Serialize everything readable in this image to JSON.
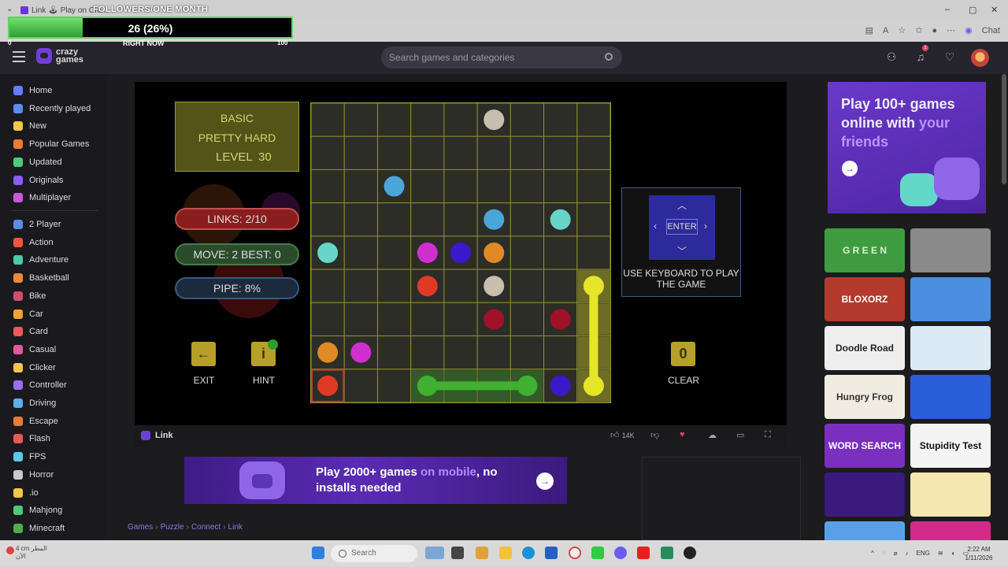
{
  "browser": {
    "tab_title": "Link 🕹 Play on Cra...",
    "chat_label": "Chat"
  },
  "overlay": {
    "title": "FOLLOWERS/ONE MONTH",
    "count": "26 (26%)",
    "progress_fraction": 0.26,
    "min_label": "0",
    "now_label": "RIGHT NOW",
    "max_label": "100"
  },
  "header": {
    "logo_line1": "crazy",
    "logo_line2": "games",
    "search_placeholder": "Search games and categories",
    "notification_count": "1"
  },
  "sidebar": {
    "items": [
      {
        "label": "Home",
        "color": "#6a7cf2"
      },
      {
        "label": "Recently played",
        "color": "#5a8de8"
      },
      {
        "label": "New",
        "color": "#f2c64a"
      },
      {
        "label": "Popular Games",
        "color": "#ef7a35"
      },
      {
        "label": "Updated",
        "color": "#4fc97a"
      },
      {
        "label": "Originals",
        "color": "#8a5cf0"
      },
      {
        "label": "Multiplayer",
        "color": "#c85ad9"
      },
      {
        "label": "2 Player",
        "color": "#5a8de8"
      },
      {
        "label": "Action",
        "color": "#e8593a"
      },
      {
        "label": "Adventure",
        "color": "#4fc9a7"
      },
      {
        "label": "Basketball",
        "color": "#ef8a35"
      },
      {
        "label": "Bike",
        "color": "#d64a6f"
      },
      {
        "label": "Car",
        "color": "#f2a23a"
      },
      {
        "label": "Card",
        "color": "#e85a5a"
      },
      {
        "label": "Casual",
        "color": "#e05aa0"
      },
      {
        "label": "Clicker",
        "color": "#f2c64a"
      },
      {
        "label": "Controller",
        "color": "#9a6ef0"
      },
      {
        "label": "Driving",
        "color": "#5ab0e8"
      },
      {
        "label": "Escape",
        "color": "#e87a3a"
      },
      {
        "label": "Flash",
        "color": "#e85a5a"
      },
      {
        "label": "FPS",
        "color": "#5ac9e8"
      },
      {
        "label": "Horror",
        "color": "#c8c8c8"
      },
      {
        "label": ".io",
        "color": "#f2c64a"
      },
      {
        "label": "Mahjong",
        "color": "#4fc97a"
      },
      {
        "label": "Minecraft",
        "color": "#4fae4a"
      }
    ]
  },
  "game": {
    "level_mode": "BASIC",
    "difficulty": "PRETTY HARD",
    "level_label": "LEVEL",
    "level_value": "30",
    "links": "LINKS:  2/10",
    "moves": "MOVE: 2    BEST: 0",
    "pipe": "PIPE:  8%",
    "exit_label": "EXIT",
    "hint_label": "HINT",
    "clear_label": "CLEAR",
    "clear_count": "0",
    "enter_label": "ENTER",
    "keyboard_text": "USE KEYBOARD TO PLAY THE GAME",
    "dots": [
      {
        "col": 5,
        "row": 0,
        "color": "#c9bfae"
      },
      {
        "col": 2,
        "row": 2,
        "color": "#4aa6d9"
      },
      {
        "col": 5,
        "row": 3,
        "color": "#4aa6d9"
      },
      {
        "col": 7,
        "row": 3,
        "color": "#67d6c8"
      },
      {
        "col": 0,
        "row": 4,
        "color": "#67d6c8"
      },
      {
        "col": 3,
        "row": 4,
        "color": "#d02fcf"
      },
      {
        "col": 4,
        "row": 4,
        "color": "#3b18c9"
      },
      {
        "col": 5,
        "row": 4,
        "color": "#e08a25"
      },
      {
        "col": 3,
        "row": 5,
        "color": "#e03a25"
      },
      {
        "col": 5,
        "row": 5,
        "color": "#c9bfae"
      },
      {
        "col": 5,
        "row": 6,
        "color": "#a0122a"
      },
      {
        "col": 7,
        "row": 6,
        "color": "#a0122a"
      },
      {
        "col": 0,
        "row": 7,
        "color": "#e08a25"
      },
      {
        "col": 1,
        "row": 7,
        "color": "#d02fcf"
      },
      {
        "col": 0,
        "row": 8,
        "color": "#e03a25"
      },
      {
        "col": 7,
        "row": 8,
        "color": "#3b18c9"
      }
    ],
    "pipes": [
      {
        "color": "#3fb02f",
        "cells": [
          [
            3,
            8
          ],
          [
            4,
            8
          ],
          [
            5,
            8
          ],
          [
            6,
            8
          ]
        ]
      },
      {
        "color": "#e5e52a",
        "cells": [
          [
            8,
            5
          ],
          [
            8,
            6
          ],
          [
            8,
            7
          ],
          [
            8,
            8
          ]
        ]
      }
    ]
  },
  "infobar": {
    "game_name": "Link",
    "likes": "14K"
  },
  "banner": {
    "text_a": "Play 2000+ games ",
    "text_highlight": "on mobile",
    "text_b": ", no installs needed"
  },
  "breadcrumb": [
    "Games",
    "Puzzle",
    "Connect",
    "Link"
  ],
  "promo": {
    "text_a": "Play 100+ games online with ",
    "text_highlight": "your friends"
  },
  "thumbnails": [
    {
      "label": "G R E E N",
      "bg": "#3f9b3f",
      "fg": "#d6f2d6"
    },
    {
      "label": "",
      "bg": "#8a8a8a",
      "fg": "#ffffff"
    },
    {
      "label": "BLOXORZ",
      "bg": "#b33a2d",
      "fg": "#ffffff"
    },
    {
      "label": "",
      "bg": "#4b8fe0",
      "fg": "#ffffff"
    },
    {
      "label": "Doodle Road",
      "bg": "#eeeeee",
      "fg": "#222222"
    },
    {
      "label": "",
      "bg": "#dceaf5",
      "fg": "#4b8fe0"
    },
    {
      "label": "Hungry Frog",
      "bg": "#f0ece2",
      "fg": "#333333"
    },
    {
      "label": "",
      "bg": "#2b5fd9",
      "fg": "#ffffff"
    },
    {
      "label": "WORD SEARCH",
      "bg": "#7a2fbf",
      "fg": "#ffffff"
    },
    {
      "label": "Stupidity Test",
      "bg": "#f4f4f4",
      "fg": "#111111"
    },
    {
      "label": "",
      "bg": "#3a1a7a",
      "fg": "#ffffff"
    },
    {
      "label": "",
      "bg": "#f4e7b0",
      "fg": "#b08a20"
    },
    {
      "label": "",
      "bg": "#5aa0e8",
      "fg": "#ffffff"
    },
    {
      "label": "",
      "bg": "#d62a8a",
      "fg": "#ffffff"
    }
  ],
  "taskbar": {
    "weather_line1": "4 cm المطر",
    "weather_line2": "الآن",
    "search_label": "Search",
    "lang": "ENG",
    "time": "2:22 AM",
    "date": "1/11/2026"
  }
}
